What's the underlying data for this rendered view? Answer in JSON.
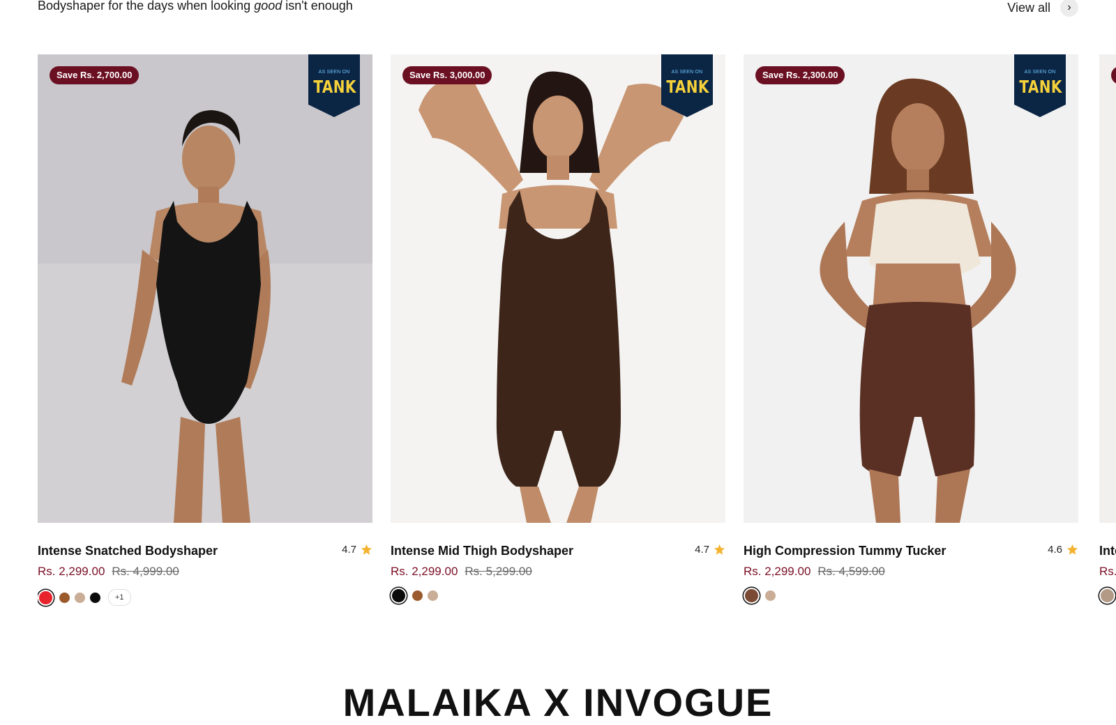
{
  "header": {
    "subtitle_before": "Bodyshaper for the days when looking ",
    "subtitle_emphasis": "good",
    "subtitle_after": " isn't enough",
    "view_all_label": "View all",
    "view_all_icon": "chevron-right-icon",
    "view_all_glyph": "›"
  },
  "products": [
    {
      "save_label": "Save Rs. 2,700.00",
      "badge_small": "AS SEEN ON",
      "badge_big": "TANK",
      "title": "Intense Snatched Bodyshaper",
      "rating": "4.7",
      "price": "Rs. 2,299.00",
      "compare_price": "Rs. 4,999.00",
      "swatches": [
        "#e8232b",
        "#9a5a2c",
        "#c9ad96",
        "#0b0b0b"
      ],
      "selected_swatch": 0,
      "more_swatches": "+1",
      "photo_bg": "#d4d2d4",
      "garment_color": "#141414"
    },
    {
      "save_label": "Save Rs. 3,000.00",
      "badge_small": "AS SEEN ON",
      "badge_big": "TANK",
      "title": "Intense Mid Thigh Bodyshaper",
      "rating": "4.7",
      "price": "Rs. 2,299.00",
      "compare_price": "Rs. 5,299.00",
      "swatches": [
        "#0b0b0b",
        "#9a5a2c",
        "#c9ad96"
      ],
      "selected_swatch": 0,
      "more_swatches": "",
      "photo_bg": "#f4f3f1",
      "garment_color": "#3d2519"
    },
    {
      "save_label": "Save Rs. 2,300.00",
      "badge_small": "AS SEEN ON",
      "badge_big": "TANK",
      "title": "High Compression Tummy Tucker",
      "rating": "4.6",
      "price": "Rs. 2,299.00",
      "compare_price": "Rs. 4,599.00",
      "swatches": [
        "#7b4a35",
        "#c9ad96"
      ],
      "selected_swatch": 0,
      "more_swatches": "",
      "photo_bg": "#f1f1f1",
      "garment_color": "#5a3024"
    }
  ],
  "peek_product": {
    "title": "Inte",
    "price": "Rs."
  },
  "section_heading": "MALAIKA X INVOGUE",
  "colors": {
    "accent_price": "#7a0e24",
    "save_badge": "#6b0f22",
    "tank_badge_bg": "#0b2545",
    "tank_badge_text": "#f6d23a",
    "star": "#f4b32e"
  }
}
